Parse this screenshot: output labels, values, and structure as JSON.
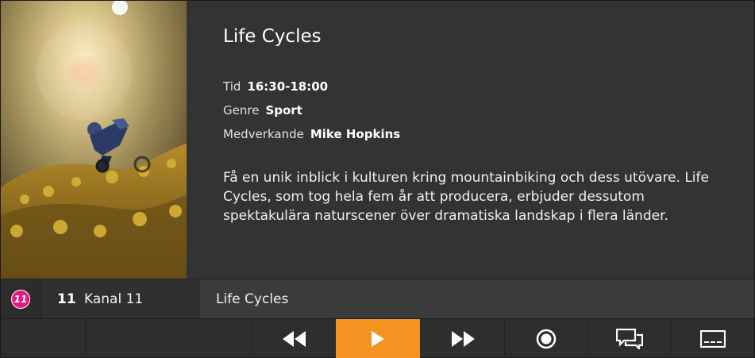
{
  "program": {
    "title": "Life Cycles",
    "time_label": "Tid",
    "time_value": "16:30-18:00",
    "genre_label": "Genre",
    "genre_value": "Sport",
    "cast_label": "Medverkande",
    "cast_value": "Mike Hopkins",
    "description": "Få en unik inblick i kulturen kring mountainbiking och dess utövare. Life Cycles, som tog hela fem år att producera, erbjuder dessutom spektakulära naturscener över dramatiska landskap i flera länder."
  },
  "channel": {
    "logo_icon": "kanal-11-logo-icon",
    "logo_text": "11",
    "number": "11",
    "name": "Kanal 11",
    "current_program": "Life Cycles"
  },
  "controls": {
    "items": [
      "rewind-icon",
      "play-icon",
      "fast-forward-icon",
      "record-icon",
      "chat-icon",
      "subtitles-icon"
    ],
    "active": "play-icon"
  },
  "colors": {
    "accent": "#f39322",
    "background": "#333333",
    "channel_logo": "#e4197f"
  }
}
